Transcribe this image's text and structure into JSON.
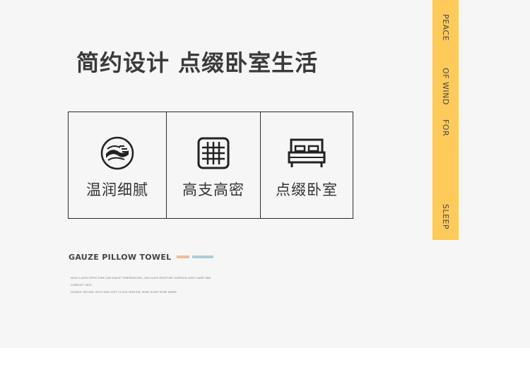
{
  "headline": "简约设计 点缀卧室生活",
  "features": [
    {
      "label": "温润细腻",
      "icon": "wave-fabric-icon"
    },
    {
      "label": "高支高密",
      "icon": "grid-weave-icon"
    },
    {
      "label": "点缀卧室",
      "icon": "bed-icon"
    }
  ],
  "sidebar": {
    "words": [
      "PEACE",
      "OF WIND",
      "FOR",
      "SLEEP"
    ]
  },
  "brand": {
    "title": "GAUZE PILLOW TOWEL",
    "swatches": [
      "#f0bc97",
      "#a8cfd6"
    ],
    "fine_print": [
      "MULTI-LAYER STRUCTURE CAN ADJUST TEMPERATURE, CIRCULATE MOISTURE OVERSOIL KEEP LAYER AND",
      "CONDUCT HEAT,",
      "DOUBLE FEELING, BOTH ADD SOFT CLOUD VERSION, MAKE SLEEP MORE WARM."
    ]
  },
  "colors": {
    "panel_bg": "#f6f6f6",
    "sidebar_bg": "#fecb5a",
    "ink": "#2b2b2b"
  }
}
